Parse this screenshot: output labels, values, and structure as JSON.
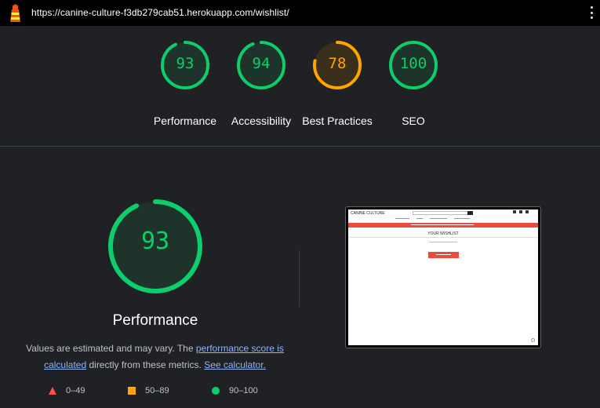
{
  "topbar": {
    "url": "https://canine-culture-f3db279cab51.herokuapp.com/wishlist/",
    "logo_icon": "lighthouse-icon",
    "menu_icon": "kebab-menu-icon"
  },
  "gauges": [
    {
      "score": "93",
      "label": "Performance",
      "color": "#0cce6b"
    },
    {
      "score": "94",
      "label": "Accessibility",
      "color": "#0cce6b"
    },
    {
      "score": "78",
      "label": "Best Practices",
      "color": "#ffa400"
    },
    {
      "score": "100",
      "label": "SEO",
      "color": "#0cce6b"
    }
  ],
  "performance": {
    "score": "93",
    "title": "Performance",
    "desc_prefix": "Values are estimated and may vary. The ",
    "link_score": "performance score is calculated",
    "desc_middle": " directly from these metrics. ",
    "link_calculator": "See calculator."
  },
  "legend": [
    {
      "range": "0–49",
      "color": "#ff4e42",
      "shape": "triangle"
    },
    {
      "range": "50–89",
      "color": "#ffa400",
      "shape": "square"
    },
    {
      "range": "90–100",
      "color": "#0cce6b",
      "shape": "circle"
    }
  ],
  "screenshot": {
    "brand": "CANINE CULTURE",
    "heading": "YOUR WISHLIST"
  }
}
